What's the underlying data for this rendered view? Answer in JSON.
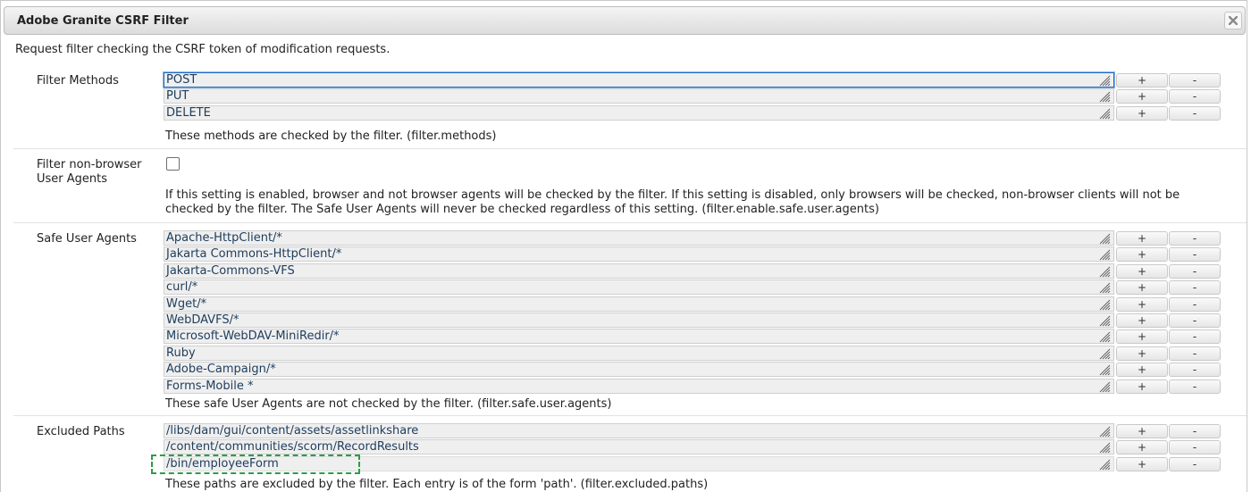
{
  "dialog": {
    "title": "Adobe Granite CSRF Filter",
    "close_icon": "close-icon",
    "description": "Request filter checking the CSRF token of modification requests."
  },
  "controls": {
    "add_label": "+",
    "remove_label": "-"
  },
  "filter_methods": {
    "label": "Filter Methods",
    "values": [
      "POST",
      "PUT",
      "DELETE"
    ],
    "hint": "These methods are checked by the filter. (filter.methods)"
  },
  "filter_non_browser": {
    "label": "Filter non-browser User Agents",
    "checked": false,
    "hint": "If this setting is enabled, browser and not browser agents will be checked by the filter. If this setting is disabled, only browsers will be checked, non-browser clients will not be checked by the filter. The Safe User Agents will never be checked regardless of this setting. (filter.enable.safe.user.agents)"
  },
  "safe_user_agents": {
    "label": "Safe User Agents",
    "values": [
      "Apache-HttpClient/*",
      "Jakarta Commons-HttpClient/*",
      "Jakarta-Commons-VFS",
      "curl/*",
      "Wget/*",
      "WebDAVFS/*",
      "Microsoft-WebDAV-MiniRedir/*",
      "Ruby",
      "Adobe-Campaign/*",
      "Forms-Mobile *"
    ],
    "hint": "These safe User Agents are not checked by the filter. (filter.safe.user.agents)"
  },
  "excluded_paths": {
    "label": "Excluded Paths",
    "values": [
      "/libs/dam/gui/content/assets/assetlinkshare",
      "/content/communities/scorm/RecordResults",
      "/bin/employeeForm"
    ],
    "hint": "These paths are excluded by the filter. Each entry is of the form 'path'. (filter.excluded.paths)"
  },
  "colors": {
    "highlight": "#2a9d4a",
    "focus": "#1f6cc2",
    "text": "#1d3c5c"
  }
}
